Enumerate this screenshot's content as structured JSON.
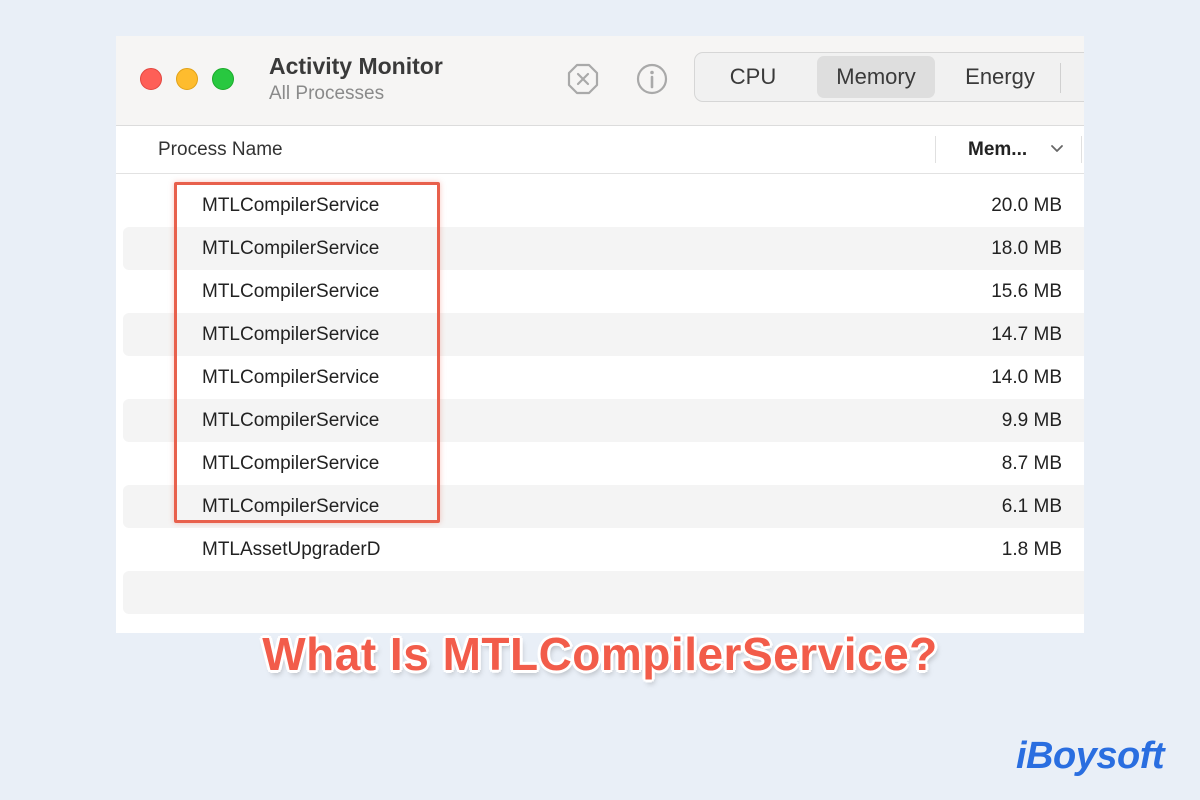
{
  "window": {
    "title": "Activity Monitor",
    "subtitle": "All Processes",
    "toolbar": {
      "stop_icon": "stop-process-icon",
      "info_icon": "info-icon"
    },
    "tabs": [
      {
        "label": "CPU"
      },
      {
        "label": "Memory",
        "selected": true
      },
      {
        "label": "Energy"
      }
    ]
  },
  "table": {
    "columns": {
      "name": "Process Name",
      "memory": "Mem..."
    },
    "rows": [
      {
        "name": "MTLCompilerService",
        "memory": "20.0 MB"
      },
      {
        "name": "MTLCompilerService",
        "memory": "18.0 MB"
      },
      {
        "name": "MTLCompilerService",
        "memory": "15.6 MB"
      },
      {
        "name": "MTLCompilerService",
        "memory": "14.7 MB"
      },
      {
        "name": "MTLCompilerService",
        "memory": "14.0 MB"
      },
      {
        "name": "MTLCompilerService",
        "memory": "9.9 MB"
      },
      {
        "name": "MTLCompilerService",
        "memory": "8.7 MB"
      },
      {
        "name": "MTLCompilerService",
        "memory": "6.1 MB"
      },
      {
        "name": "MTLAssetUpgraderD",
        "memory": "1.8 MB"
      }
    ]
  },
  "overlay": {
    "headline": "What Is MTLCompilerService?",
    "brand": "iBoysoft",
    "highlight_color": "#e8604c"
  },
  "colors": {
    "close": "#fe5f57",
    "minimize": "#febc2e",
    "maximize": "#28c840",
    "headline": "#f25c4a",
    "brand": "#2a6ee0"
  }
}
